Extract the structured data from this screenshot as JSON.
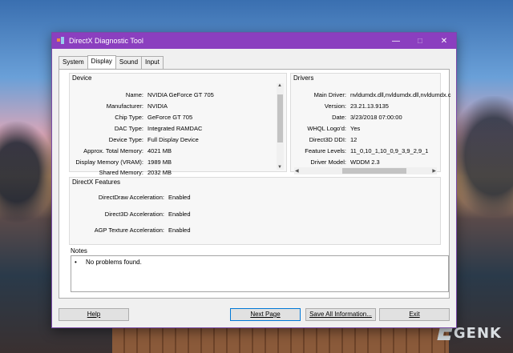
{
  "window": {
    "title": "DirectX Diagnostic Tool",
    "controls": {
      "minimize": "—",
      "maximize": "□",
      "close": "✕"
    }
  },
  "tabs": [
    {
      "label": "System"
    },
    {
      "label": "Display",
      "active": true
    },
    {
      "label": "Sound"
    },
    {
      "label": "Input"
    }
  ],
  "device": {
    "title": "Device",
    "rows": [
      {
        "key": "Name:",
        "value": "NVIDIA GeForce GT 705"
      },
      {
        "key": "Manufacturer:",
        "value": "NVIDIA"
      },
      {
        "key": "Chip Type:",
        "value": "GeForce GT 705"
      },
      {
        "key": "DAC Type:",
        "value": "Integrated RAMDAC"
      },
      {
        "key": "Device Type:",
        "value": "Full Display Device"
      },
      {
        "key": "Approx. Total Memory:",
        "value": "4021 MB"
      },
      {
        "key": "Display Memory (VRAM):",
        "value": "1989 MB"
      },
      {
        "key": "Shared Memory:",
        "value": "2032 MB"
      }
    ]
  },
  "drivers": {
    "title": "Drivers",
    "rows": [
      {
        "key": "Main Driver:",
        "value": "nvldumdx.dll,nvldumdx.dll,nvldumdx.c"
      },
      {
        "key": "Version:",
        "value": "23.21.13.9135"
      },
      {
        "key": "Date:",
        "value": "3/23/2018 07:00:00"
      },
      {
        "key": "WHQL Logo'd:",
        "value": "Yes"
      },
      {
        "key": "Direct3D DDI:",
        "value": "12"
      },
      {
        "key": "Feature Levels:",
        "value": "11_0,10_1,10_0,9_3,9_2,9_1"
      },
      {
        "key": "Driver Model:",
        "value": "WDDM 2.3"
      }
    ]
  },
  "features": {
    "title": "DirectX Features",
    "rows": [
      {
        "key": "DirectDraw Acceleration:",
        "value": "Enabled"
      },
      {
        "key": "Direct3D Acceleration:",
        "value": "Enabled"
      },
      {
        "key": "AGP Texture Acceleration:",
        "value": "Enabled"
      }
    ]
  },
  "notes": {
    "title": "Notes",
    "bullet": "•",
    "text": "No problems found."
  },
  "buttons": {
    "help": "Help",
    "next_page": "Next Page",
    "save_all": "Save All Information...",
    "exit": "Exit"
  },
  "watermark": {
    "text": "GENK"
  }
}
